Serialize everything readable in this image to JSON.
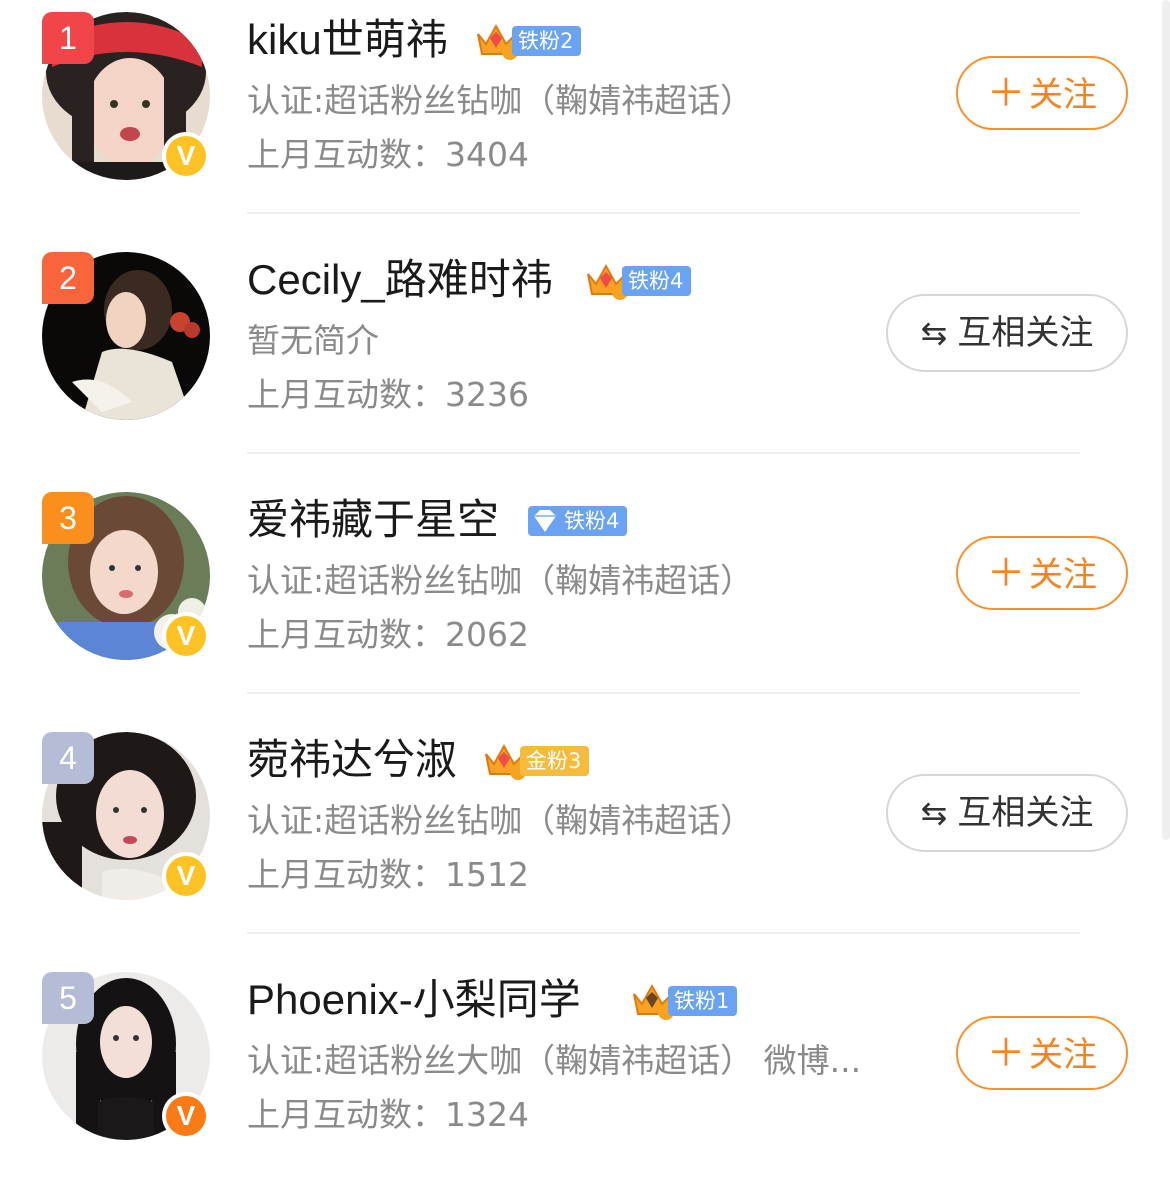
{
  "users": [
    {
      "rank": "1",
      "name": "kiku世萌祎",
      "fan_badge": {
        "label": "铁粉2",
        "type": "iron",
        "crown_level": "1"
      },
      "description": "认证:超话粉丝钻咖（鞠婧祎超话）",
      "interaction": "上月互动数：3404",
      "verified": "V",
      "button": "关注",
      "button_plus": "＋"
    },
    {
      "rank": "2",
      "name": "Cecily_路难时祎",
      "fan_badge": {
        "label": "铁粉4",
        "type": "iron",
        "crown_level": "3"
      },
      "description": "暂无简介",
      "interaction": "上月互动数：3236",
      "button": "互相关注",
      "button_arrows": "⇆"
    },
    {
      "rank": "3",
      "name": "爱祎藏于星空",
      "fan_badge": {
        "label": "铁粉4",
        "type": "diamond"
      },
      "description": "认证:超话粉丝钻咖（鞠婧祎超话）",
      "interaction": "上月互动数：2062",
      "verified": "V",
      "button": "关注",
      "button_plus": "＋"
    },
    {
      "rank": "4",
      "name": "菀祎达兮淑",
      "fan_badge": {
        "label": "金粉3",
        "type": "gold",
        "crown_level": "4"
      },
      "description": "认证:超话粉丝钻咖（鞠婧祎超话）",
      "interaction": "上月互动数：1512",
      "verified": "V",
      "button": "互相关注",
      "button_arrows": "⇆"
    },
    {
      "rank": "5",
      "name": "Phoenix-小梨同学",
      "fan_badge": {
        "label": "铁粉1",
        "type": "iron",
        "crown_level": "5"
      },
      "description": "认证:超话粉丝大咖（鞠婧祎超话） 微博...",
      "interaction": "上月互动数：1324",
      "verified": "V",
      "button": "关注",
      "button_plus": "＋"
    }
  ],
  "colors": {
    "accent_orange": "#f5831f",
    "rank1": "#f2454a",
    "rank2": "#f8643b",
    "rank3": "#fb8f1d",
    "rank_other": "#b4bcd6",
    "iron_badge": "#6aa3f3",
    "gold_badge": "#f7bb3b"
  }
}
